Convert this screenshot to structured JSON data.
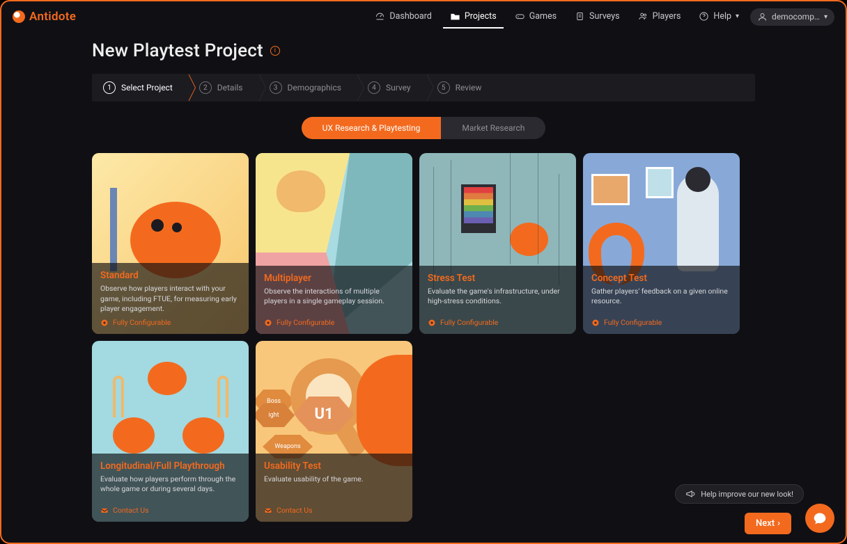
{
  "brand": {
    "name": "Antidote"
  },
  "nav": {
    "items": [
      {
        "label": "Dashboard",
        "icon": "gauge-icon"
      },
      {
        "label": "Projects",
        "icon": "folder-icon",
        "active": true
      },
      {
        "label": "Games",
        "icon": "gamepad-icon"
      },
      {
        "label": "Surveys",
        "icon": "clipboard-icon"
      },
      {
        "label": "Players",
        "icon": "users-icon"
      },
      {
        "label": "Help",
        "icon": "help-icon",
        "dropdown": true
      }
    ],
    "user": "democomp…"
  },
  "page": {
    "title": "New Playtest Project"
  },
  "stepper": {
    "steps": [
      {
        "num": "1",
        "label": "Select Project",
        "active": true
      },
      {
        "num": "2",
        "label": "Details"
      },
      {
        "num": "3",
        "label": "Demographics"
      },
      {
        "num": "4",
        "label": "Survey"
      },
      {
        "num": "5",
        "label": "Review"
      }
    ]
  },
  "toggle": {
    "options": [
      {
        "label": "UX Research & Playtesting",
        "active": true
      },
      {
        "label": "Market Research"
      }
    ]
  },
  "cards": [
    {
      "art": "art-standard",
      "title": "Standard",
      "desc": "Observe how players interact with your game, including FTUE, for measuring early player engagement.",
      "footer": {
        "type": "config",
        "label": "Fully Configurable"
      },
      "selected": true
    },
    {
      "art": "art-multiplayer",
      "title": "Multiplayer",
      "desc": "Observe the interactions of multiple players in a single gameplay session.",
      "footer": {
        "type": "config",
        "label": "Fully Configurable"
      }
    },
    {
      "art": "art-stress",
      "title": "Stress Test",
      "desc": "Evaluate the game's infrastructure, under high-stress conditions.",
      "footer": {
        "type": "config",
        "label": "Fully Configurable"
      }
    },
    {
      "art": "art-concept",
      "title": "Concept Test",
      "desc": "Gather players' feedback on a given online resource.",
      "footer": {
        "type": "config",
        "label": "Fully Configurable"
      }
    },
    {
      "art": "art-long",
      "title": "Longitudinal/Full Playthrough",
      "desc": "Evaluate how players perform through the whole game or during several days.",
      "footer": {
        "type": "contact",
        "label": "Contact Us"
      }
    },
    {
      "art": "art-usability",
      "title": "Usability Test",
      "desc": "Evaluate usability of the game.",
      "footer": {
        "type": "contact",
        "label": "Contact Us"
      }
    }
  ],
  "footer": {
    "next": "Next",
    "help_prompt": "Help improve our new look!"
  },
  "artwork_labels": {
    "boss": "Boss",
    "fight": "ight",
    "weapons": "Weapons",
    "u1": "U1"
  }
}
